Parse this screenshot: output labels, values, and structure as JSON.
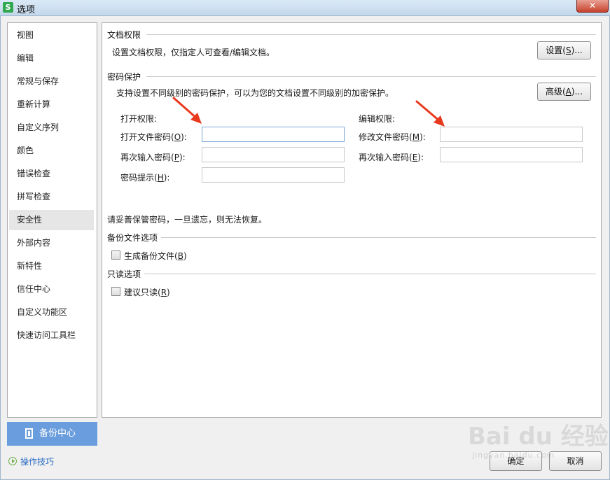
{
  "window": {
    "title": "选项",
    "app_icon": "S",
    "close_symbol": "✕"
  },
  "nav": {
    "items": [
      {
        "label": "视图"
      },
      {
        "label": "编辑"
      },
      {
        "label": "常规与保存"
      },
      {
        "label": "重新计算"
      },
      {
        "label": "自定义序列"
      },
      {
        "label": "颜色"
      },
      {
        "label": "错误检查"
      },
      {
        "label": "拼写检查"
      },
      {
        "label": "安全性",
        "active": true
      },
      {
        "label": "外部内容"
      },
      {
        "label": "新特性"
      },
      {
        "label": "信任中心"
      },
      {
        "label": "自定义功能区"
      },
      {
        "label": "快速访问工具栏"
      }
    ],
    "active_index": 8
  },
  "doc_permission": {
    "title": "文档权限",
    "desc": "设置文档权限，仅指定人可查看/编辑文档。",
    "settings_button": {
      "label": "设置",
      "key": "S",
      "suffix": "..."
    }
  },
  "password_protection": {
    "title": "密码保护",
    "desc": "支持设置不同级别的密码保护，可以为您的文档设置不同级别的加密保护。",
    "advanced_button": {
      "label": "高级",
      "key": "A",
      "suffix": "..."
    },
    "open": {
      "title": "打开权限:",
      "password": {
        "label": "打开文件密码",
        "key": "O",
        "value": ""
      },
      "confirm": {
        "label": "再次输入密码",
        "key": "P",
        "value": ""
      },
      "hint": {
        "label": "密码提示",
        "key": "H",
        "value": ""
      }
    },
    "edit": {
      "title": "编辑权限:",
      "password": {
        "label": "修改文件密码",
        "key": "M",
        "value": ""
      },
      "confirm": {
        "label": "再次输入密码",
        "key": "E",
        "value": ""
      }
    },
    "warning": "请妥善保管密码，一旦遗忘，则无法恢复。"
  },
  "backup_options": {
    "title": "备份文件选项",
    "checkbox": {
      "label": "生成备份文件",
      "key": "B",
      "checked": false
    }
  },
  "readonly_options": {
    "title": "只读选项",
    "checkbox": {
      "label": "建议只读",
      "key": "R",
      "checked": false
    }
  },
  "footer": {
    "backup_center": "备份中心",
    "tips": "操作技巧",
    "ok": "确定",
    "cancel": "取消"
  },
  "watermark": {
    "logo": "Bai du 经验",
    "sub": "jingyan.baidu.com"
  },
  "colors": {
    "accent": "#6a9ddd",
    "arrow": "#e8391e",
    "link": "#2b6cc4"
  }
}
